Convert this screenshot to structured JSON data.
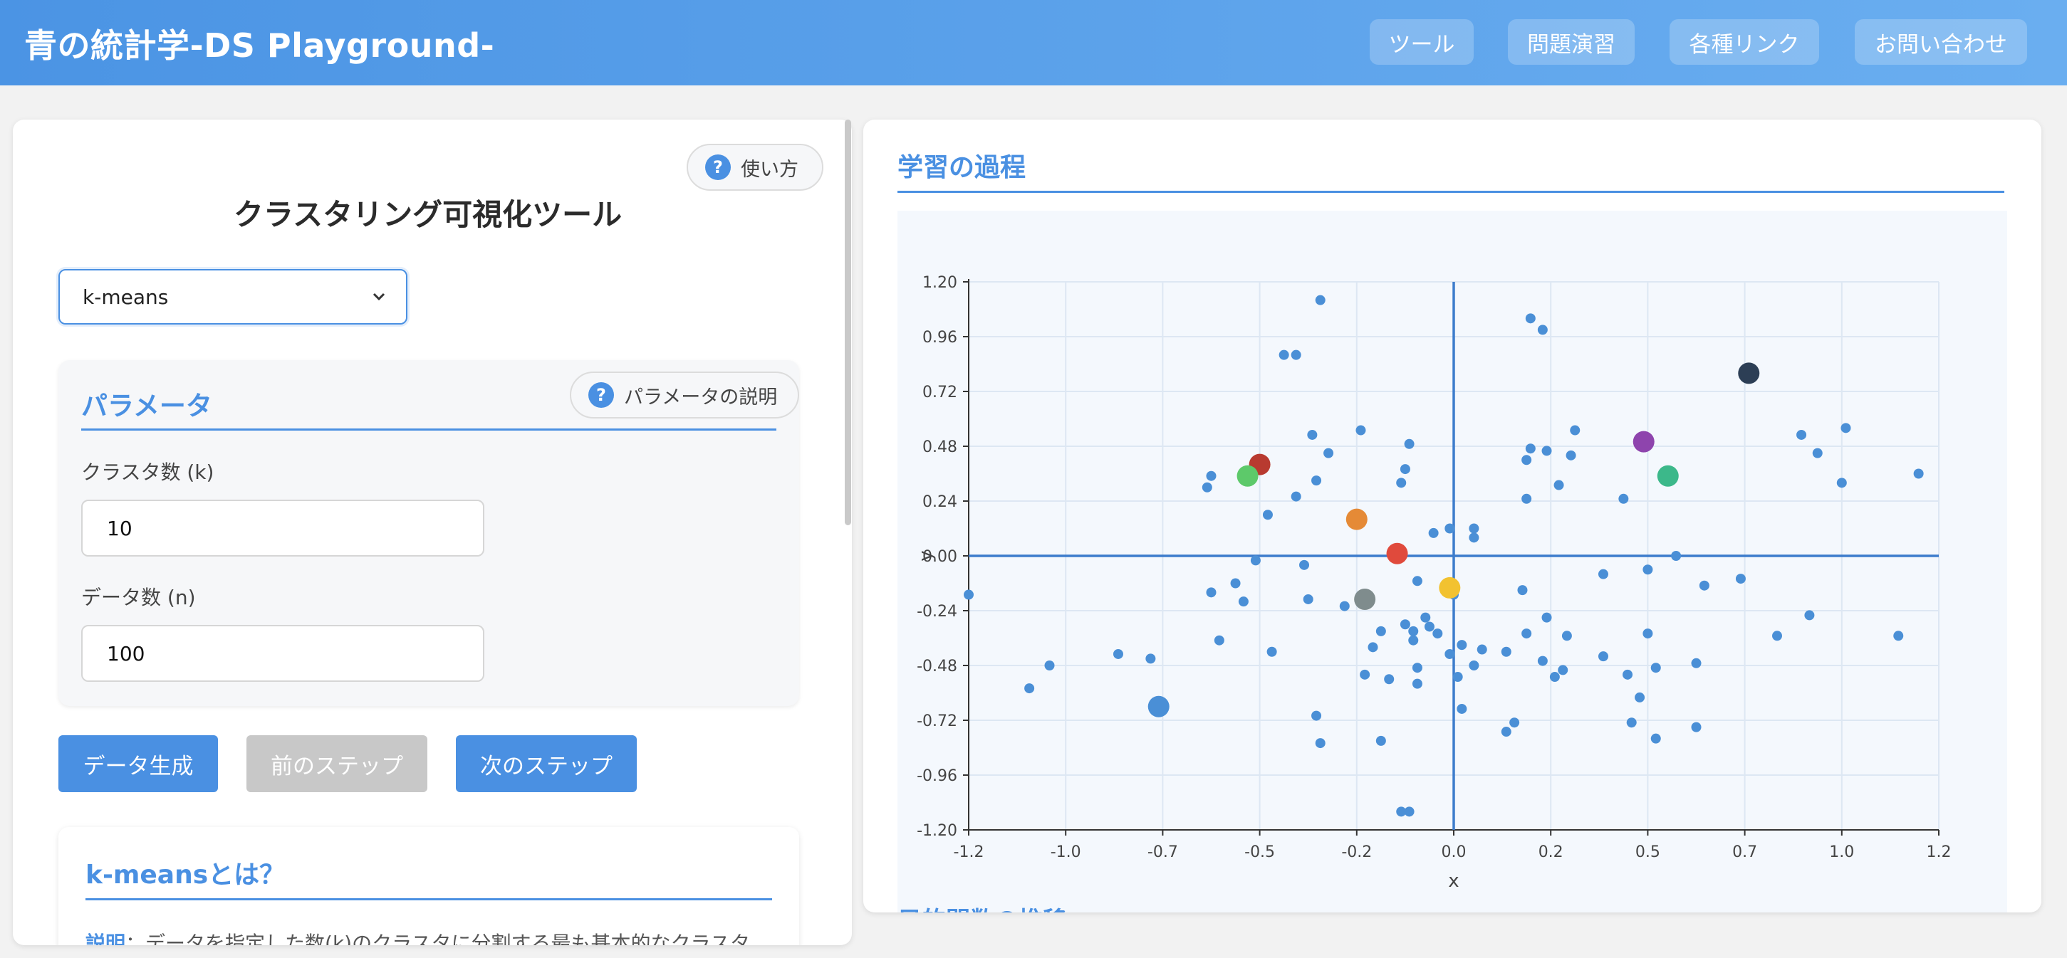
{
  "header": {
    "brand": "青の統計学-DS Playground-",
    "nav": [
      {
        "label": "ツール"
      },
      {
        "label": "問題演習"
      },
      {
        "label": "各種リンク"
      },
      {
        "label": "お問い合わせ"
      }
    ]
  },
  "left": {
    "help_label": "使い方",
    "tool_title": "クラスタリング可視化ツール",
    "algorithm_select": {
      "value": "k-means"
    },
    "params": {
      "title": "パラメータ",
      "help_label": "パラメータの説明",
      "k_label": "クラスタ数 (k)",
      "k_value": "10",
      "n_label": "データ数 (n)",
      "n_value": "100"
    },
    "buttons": {
      "generate": "データ生成",
      "prev": "前のステップ",
      "next": "次のステップ"
    },
    "info": {
      "title": "k-meansとは？",
      "desc_label": "説明",
      "desc_text": "：データを指定した数(k)のクラスタに分割する最も基本的なクラスタ"
    }
  },
  "right": {
    "title": "学習の過程",
    "next_section_title": "目的関数の推移",
    "colors": {
      "accent": "#4a90e2",
      "points": "#4a8fd6"
    }
  },
  "chart_data": {
    "type": "scatter",
    "xlabel": "x",
    "ylabel": "y",
    "xlim": [
      -1.2,
      1.2
    ],
    "ylim": [
      -1.2,
      1.2
    ],
    "xticks": [
      "-1.2",
      "-1.0",
      "-0.7",
      "-0.5",
      "-0.2",
      "0.0",
      "0.2",
      "0.5",
      "0.7",
      "1.0",
      "1.2"
    ],
    "yticks": [
      "1.20",
      "0.96",
      "0.72",
      "0.48",
      "0.24",
      "0.00",
      "-0.24",
      "-0.48",
      "-0.72",
      "-0.96",
      "-1.20"
    ],
    "grid": true,
    "series": [
      {
        "role": "data",
        "color": "#4a8fd6",
        "points": [
          [
            -0.33,
            1.12
          ],
          [
            0.19,
            1.04
          ],
          [
            0.22,
            0.99
          ],
          [
            -0.42,
            0.88
          ],
          [
            -0.39,
            0.88
          ],
          [
            -0.6,
            0.35
          ],
          [
            -0.61,
            0.3
          ],
          [
            -0.35,
            0.53
          ],
          [
            -0.23,
            0.55
          ],
          [
            -0.11,
            0.49
          ],
          [
            -0.34,
            0.33
          ],
          [
            -0.39,
            0.26
          ],
          [
            -0.46,
            0.18
          ],
          [
            -0.12,
            0.38
          ],
          [
            -0.13,
            0.32
          ],
          [
            0.05,
            0.12
          ],
          [
            0.23,
            0.46
          ],
          [
            0.19,
            0.47
          ],
          [
            0.29,
            0.44
          ],
          [
            0.3,
            0.55
          ],
          [
            0.26,
            0.31
          ],
          [
            0.18,
            0.25
          ],
          [
            0.86,
            0.53
          ],
          [
            0.9,
            0.45
          ],
          [
            0.97,
            0.56
          ],
          [
            1.15,
            0.36
          ],
          [
            0.96,
            0.32
          ],
          [
            0.88,
            -0.26
          ],
          [
            1.1,
            -0.35
          ],
          [
            0.8,
            -0.35
          ],
          [
            0.71,
            -0.1
          ],
          [
            0.55,
            0.0
          ],
          [
            0.48,
            -0.06
          ],
          [
            -1.2,
            -0.17
          ],
          [
            -0.6,
            -0.16
          ],
          [
            -0.54,
            -0.12
          ],
          [
            -0.52,
            -0.2
          ],
          [
            -0.49,
            -0.02
          ],
          [
            -0.37,
            -0.04
          ],
          [
            -0.36,
            -0.19
          ],
          [
            -0.09,
            -0.11
          ],
          [
            0.0,
            -0.17
          ],
          [
            -0.12,
            -0.3
          ],
          [
            -0.18,
            -0.33
          ],
          [
            -0.1,
            -0.33
          ],
          [
            -0.07,
            -0.27
          ],
          [
            -0.06,
            -0.31
          ],
          [
            -0.04,
            -0.34
          ],
          [
            0.02,
            -0.39
          ],
          [
            -0.1,
            -0.37
          ],
          [
            -0.01,
            -0.43
          ],
          [
            0.18,
            -0.34
          ],
          [
            0.13,
            -0.42
          ],
          [
            0.28,
            -0.35
          ],
          [
            0.23,
            -0.27
          ],
          [
            0.48,
            -0.34
          ],
          [
            0.5,
            -0.49
          ],
          [
            0.43,
            -0.52
          ],
          [
            0.37,
            -0.44
          ],
          [
            0.25,
            -0.53
          ],
          [
            -0.27,
            -0.22
          ],
          [
            -0.16,
            -0.54
          ],
          [
            -0.09,
            -0.49
          ],
          [
            -0.22,
            -0.52
          ],
          [
            -0.09,
            -0.56
          ],
          [
            0.01,
            -0.53
          ],
          [
            0.13,
            -0.77
          ],
          [
            0.15,
            -0.73
          ],
          [
            0.27,
            -0.5
          ],
          [
            0.22,
            -0.46
          ],
          [
            0.44,
            -0.73
          ],
          [
            0.5,
            -0.8
          ],
          [
            0.46,
            -0.62
          ],
          [
            0.6,
            -0.47
          ],
          [
            0.6,
            -0.75
          ],
          [
            -1.05,
            -0.58
          ],
          [
            -1.0,
            -0.48
          ],
          [
            -0.83,
            -0.43
          ],
          [
            -0.75,
            -0.45
          ],
          [
            -0.58,
            -0.37
          ],
          [
            -0.45,
            -0.42
          ],
          [
            -0.34,
            -0.7
          ],
          [
            -0.33,
            -0.82
          ],
          [
            -0.18,
            -0.81
          ],
          [
            -0.2,
            -0.4
          ],
          [
            -0.11,
            -1.12
          ],
          [
            -0.13,
            -1.12
          ],
          [
            0.02,
            -0.67
          ],
          [
            0.17,
            -0.15
          ],
          [
            0.37,
            -0.08
          ],
          [
            0.62,
            -0.13
          ],
          [
            0.05,
            -0.48
          ],
          [
            -0.01,
            0.12
          ],
          [
            0.42,
            0.25
          ],
          [
            -0.05,
            0.1
          ],
          [
            0.05,
            0.08
          ],
          [
            -0.48,
            0.42
          ],
          [
            -0.31,
            0.45
          ],
          [
            0.07,
            -0.41
          ],
          [
            0.18,
            0.42
          ]
        ]
      },
      {
        "role": "centroids",
        "points": [
          {
            "x": 0.73,
            "y": 0.8,
            "color": "#2c3e55"
          },
          {
            "x": 0.47,
            "y": 0.5,
            "color": "#8e44ad"
          },
          {
            "x": 0.53,
            "y": 0.35,
            "color": "#3cb88a"
          },
          {
            "x": -0.48,
            "y": 0.4,
            "color": "#b83a30"
          },
          {
            "x": -0.51,
            "y": 0.35,
            "color": "#5dc96a"
          },
          {
            "x": -0.24,
            "y": 0.16,
            "color": "#e58a36"
          },
          {
            "x": -0.14,
            "y": 0.01,
            "color": "#e04a3c"
          },
          {
            "x": -0.22,
            "y": -0.19,
            "color": "#7f8c8d"
          },
          {
            "x": -0.01,
            "y": -0.14,
            "color": "#f2c230"
          },
          {
            "x": -0.73,
            "y": -0.66,
            "color": "#4a8fd6"
          }
        ]
      }
    ]
  }
}
